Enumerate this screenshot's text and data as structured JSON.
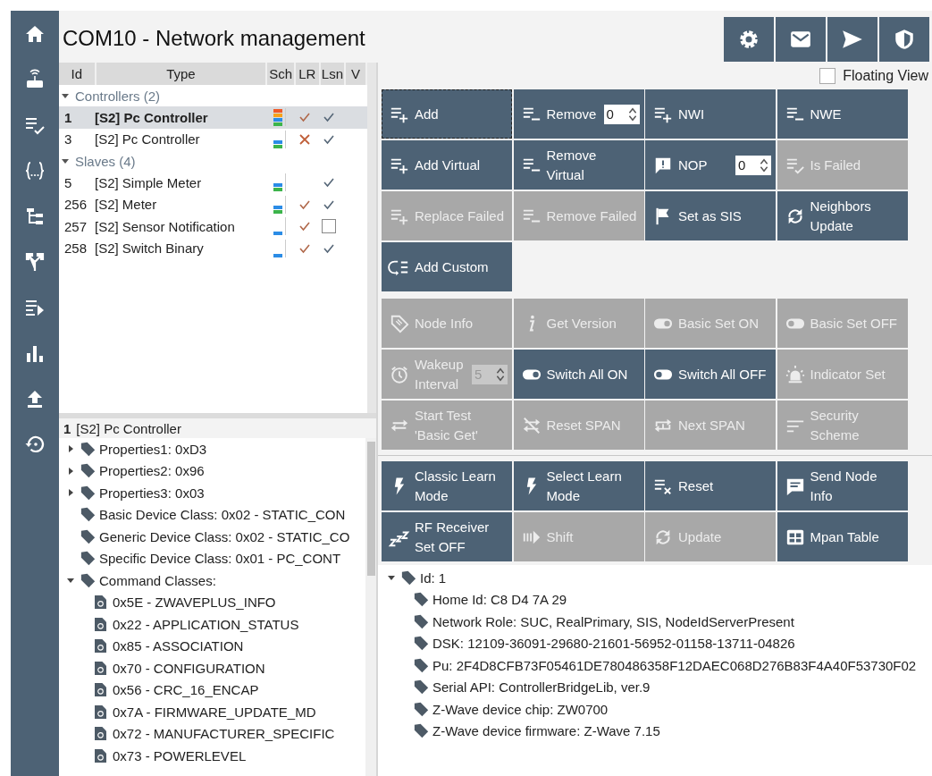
{
  "title": "COM10 - Network management",
  "node_table": {
    "columns": [
      "Id",
      "Type",
      "Sch",
      "LR",
      "Lsn",
      "V"
    ],
    "groups": [
      {
        "label": "Controllers (2)",
        "expanded": true,
        "rows": [
          {
            "id": "1",
            "type": "[S2] Pc Controller",
            "selected": true,
            "sch": [
              {
                "color": "#f05a28"
              },
              {
                "color": "#f7a21b"
              },
              {
                "color": "#2b8ce6"
              },
              {
                "color": "#3cb44b"
              }
            ],
            "lr": {
              "kind": "check"
            },
            "lsn_checked": true
          },
          {
            "id": "3",
            "type": "[S2] Pc Controller",
            "selected": false,
            "sch": [
              {
                "color": "#2b8ce6"
              },
              {
                "color": "#3cb44b"
              }
            ],
            "lr": {
              "kind": "cross"
            },
            "lsn_checked": true
          }
        ]
      },
      {
        "label": "Slaves (4)",
        "expanded": true,
        "rows": [
          {
            "id": "5",
            "type": "[S2] Simple Meter",
            "selected": false,
            "sch": [
              {
                "color": "#2b8ce6"
              },
              {
                "color": "#3cb44b"
              }
            ],
            "lsn_checked": true
          },
          {
            "id": "256",
            "type": "[S2] Meter",
            "selected": false,
            "sch": [
              {
                "color": "#2b8ce6"
              },
              {
                "color": "#3cb44b"
              }
            ],
            "lr": {
              "kind": "check"
            },
            "lsn_checked": true
          },
          {
            "id": "257",
            "type": "[S2] Sensor Notification",
            "selected": false,
            "sch": [
              {
                "color": "#2b8ce6"
              }
            ],
            "lr": {
              "kind": "check"
            },
            "lsn_checked": false
          },
          {
            "id": "258",
            "type": "[S2] Switch Binary",
            "selected": false,
            "sch": [
              {
                "color": "#2b8ce6"
              }
            ],
            "lr": {
              "kind": "check"
            },
            "lsn_checked": true
          }
        ]
      }
    ]
  },
  "node_details": {
    "id": "1",
    "name": "[S2] Pc Controller",
    "tree": [
      {
        "text": "Properties1: 0xD3",
        "expanded": false
      },
      {
        "text": "Properties2: 0x96",
        "expanded": false
      },
      {
        "text": "Properties3: 0x03",
        "expanded": false
      },
      {
        "text": "Basic Device Class: 0x02 - STATIC_CON"
      },
      {
        "text": "Generic Device Class: 0x02 - STATIC_CO"
      },
      {
        "text": "Specific Device Class: 0x01 - PC_CONT"
      },
      {
        "text": "Command Classes:",
        "expanded": true,
        "children": [
          {
            "text": "0x5E - ZWAVEPLUS_INFO"
          },
          {
            "text": "0x22 - APPLICATION_STATUS"
          },
          {
            "text": "0x85 - ASSOCIATION"
          },
          {
            "text": "0x70 - CONFIGURATION"
          },
          {
            "text": "0x56 - CRC_16_ENCAP"
          },
          {
            "text": "0x7A - FIRMWARE_UPDATE_MD"
          },
          {
            "text": "0x72 - MANUFACTURER_SPECIFIC"
          },
          {
            "text": "0x73 - POWERLEVEL"
          }
        ]
      }
    ]
  },
  "floating_view": {
    "label": "Floating View",
    "checked": false
  },
  "action_groups": [
    [
      {
        "label": "Add",
        "enabled": true,
        "focused": true
      },
      {
        "label": "Remove",
        "enabled": true,
        "focused": false,
        "spinner": "0"
      },
      {
        "label": "NWI",
        "enabled": true,
        "focused": false
      },
      {
        "label": "NWE",
        "enabled": true,
        "focused": false
      },
      {
        "label": "Add Virtual",
        "enabled": true,
        "focused": false
      },
      {
        "label": "Remove\nVirtual",
        "enabled": true,
        "focused": false
      },
      {
        "label": "NOP",
        "enabled": true,
        "focused": false,
        "spinner": "0"
      },
      {
        "label": "Is Failed",
        "enabled": false,
        "focused": false
      },
      {
        "label": "Replace Failed",
        "enabled": false,
        "focused": false
      },
      {
        "label": "Remove Failed",
        "enabled": false,
        "focused": false
      },
      {
        "label": "Set as SIS",
        "enabled": true,
        "focused": false
      },
      {
        "label": "Neighbors\nUpdate",
        "enabled": true,
        "focused": false
      },
      {
        "label": "Add Custom",
        "enabled": true,
        "focused": false
      }
    ],
    [
      {
        "label": "Node Info",
        "enabled": false,
        "focused": false
      },
      {
        "label": "Get Version",
        "enabled": false,
        "focused": false
      },
      {
        "label": "Basic Set ON",
        "enabled": false,
        "focused": false
      },
      {
        "label": "Basic Set OFF",
        "enabled": false,
        "focused": false
      },
      {
        "label": "Wakeup\nInterval",
        "enabled": false,
        "focused": false,
        "spinner": "5"
      },
      {
        "label": "Switch All ON",
        "enabled": true,
        "focused": false
      },
      {
        "label": "Switch All OFF",
        "enabled": true,
        "focused": false
      },
      {
        "label": "Indicator Set",
        "enabled": false,
        "focused": false
      },
      {
        "label": "Start Test\n'Basic Get'",
        "enabled": false,
        "focused": false
      },
      {
        "label": "Reset SPAN",
        "enabled": false,
        "focused": false
      },
      {
        "label": "Next SPAN",
        "enabled": false,
        "focused": false
      },
      {
        "label": "Security\nScheme",
        "enabled": false,
        "focused": false
      }
    ],
    [
      {
        "label": "Classic Learn\nMode",
        "enabled": true,
        "focused": false
      },
      {
        "label": "Select Learn\nMode",
        "enabled": true,
        "focused": false
      },
      {
        "label": "Reset",
        "enabled": true,
        "focused": false
      },
      {
        "label": "Send Node\nInfo",
        "enabled": true,
        "focused": false
      },
      {
        "label": "RF Receiver\nSet OFF",
        "enabled": true,
        "focused": false
      },
      {
        "label": "Shift",
        "enabled": false,
        "focused": false
      },
      {
        "label": "Update",
        "enabled": false,
        "focused": false
      },
      {
        "label": "Mpan Table",
        "enabled": true,
        "focused": false
      }
    ]
  ],
  "info_tree": [
    {
      "text": "Id: 1",
      "expanded": true,
      "children": [
        {
          "text": "Home Id: C8 D4 7A 29"
        },
        {
          "text": "Network Role: SUC, RealPrimary, SIS, NodeIdServerPresent"
        },
        {
          "text": "DSK: 12109-36091-29680-21601-56952-01158-13711-04826"
        },
        {
          "text": "Pu: 2F4D8CFB73F05461DE780486358F12DAEC068D276B83F4A40F53730F02"
        },
        {
          "text": "Serial API: ControllerBridgeLib, ver.9"
        },
        {
          "text": "Z-Wave device chip: ZW0700"
        },
        {
          "text": "Z-Wave device firmware: Z-Wave 7.15"
        }
      ]
    }
  ]
}
